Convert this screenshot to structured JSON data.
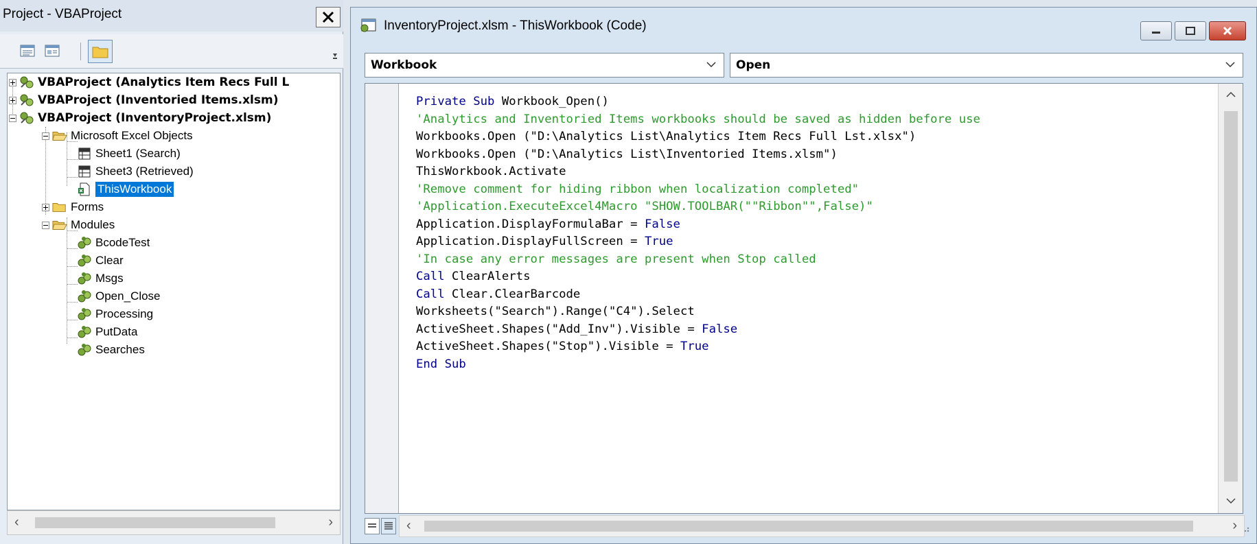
{
  "project_explorer": {
    "title": "Project - VBAProject",
    "tree": [
      {
        "label": "VBAProject (Analytics Item Recs Full L",
        "bold": true
      },
      {
        "label": "VBAProject (Inventoried Items.xlsm)",
        "bold": true
      },
      {
        "label": "VBAProject (InventoryProject.xlsm)",
        "bold": true
      },
      {
        "label": "Microsoft Excel Objects"
      },
      {
        "label": "Sheet1 (Search)"
      },
      {
        "label": "Sheet3 (Retrieved)"
      },
      {
        "label": "ThisWorkbook",
        "selected": true
      },
      {
        "label": "Forms"
      },
      {
        "label": "Modules"
      },
      {
        "label": "BcodeTest"
      },
      {
        "label": "Clear"
      },
      {
        "label": "Msgs"
      },
      {
        "label": "Open_Close"
      },
      {
        "label": "Processing"
      },
      {
        "label": "PutData"
      },
      {
        "label": "Searches"
      }
    ]
  },
  "code_window": {
    "title": "InventoryProject.xlsm - ThisWorkbook (Code)",
    "object_combo": "Workbook",
    "procedure_combo": "Open",
    "lines": [
      "Private Sub Workbook_Open()",
      "'Analytics and Inventoried Items workbooks should be saved as hidden before use",
      "Workbooks.Open (\"D:\\Analytics List\\Analytics Item Recs Full Lst.xlsx\")",
      "Workbooks.Open (\"D:\\Analytics List\\Inventoried Items.xlsm\")",
      "ThisWorkbook.Activate",
      "'Remove comment for hiding ribbon when localization completed\"",
      "'Application.ExecuteExcel4Macro \"SHOW.TOOLBAR(\"\"Ribbon\"\",False)\"",
      "Application.DisplayFormulaBar = False",
      "Application.DisplayFullScreen = True",
      "'In case any error messages are present when Stop called",
      "Call ClearAlerts",
      "Call Clear.ClearBarcode",
      "Worksheets(\"Search\").Range(\"C4\").Select",
      "ActiveSheet.Shapes(\"Add_Inv\").Visible = False",
      "ActiveSheet.Shapes(\"Stop\").Visible = True",
      "End Sub"
    ]
  },
  "colors": {
    "keyword": "#00008b",
    "comment": "#2e9b2e",
    "selection": "#0078d7"
  }
}
